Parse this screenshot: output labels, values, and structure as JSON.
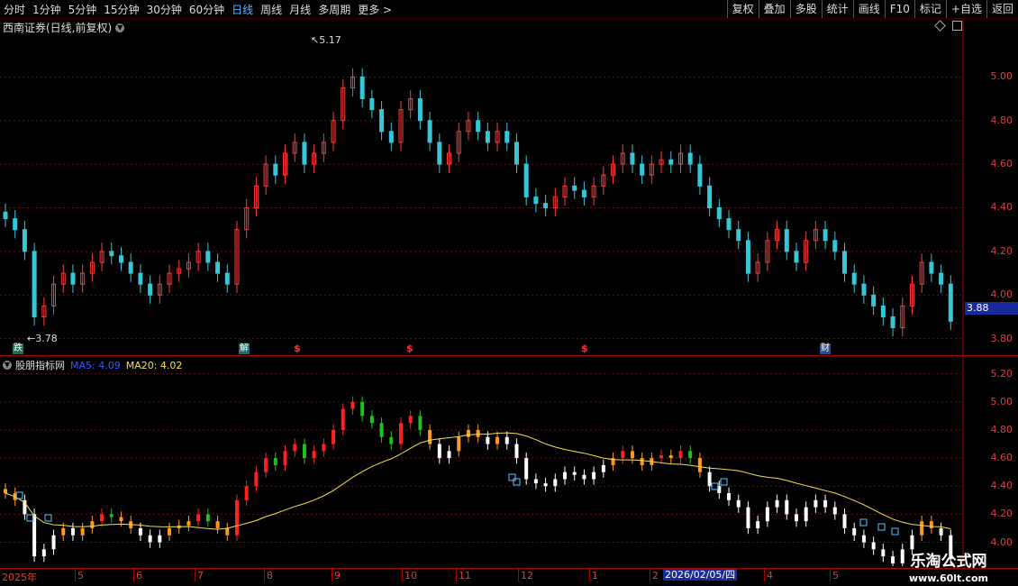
{
  "toolbar": {
    "periods": [
      "分时",
      "1分钟",
      "5分钟",
      "15分钟",
      "30分钟",
      "60分钟",
      "日线",
      "周线",
      "月线",
      "多周期",
      "更多 >"
    ],
    "active_period": "日线",
    "right_buttons": [
      "复权",
      "叠加",
      "多股",
      "统计",
      "画线",
      "F10",
      "标记",
      "+自选",
      "返回"
    ]
  },
  "stock_title": "西南证券(日线,前复权)",
  "max_price_label": "5.17",
  "min_price_label": "3.78",
  "current_price": "3.88",
  "main_axis": [
    "5.00",
    "4.80",
    "4.60",
    "4.40",
    "4.20",
    "4.00",
    "3.80"
  ],
  "indicator": {
    "name": "股朋指标网",
    "ma5": "MA5: 4.09",
    "ma20": "MA20: 4.02"
  },
  "indicator_axis": [
    "5.20",
    "5.00",
    "4.80",
    "4.60",
    "4.40",
    "4.20",
    "4.00"
  ],
  "tags": {
    "die": "跌",
    "jie": "解",
    "cai": "财",
    "s": "$"
  },
  "date_labels": [
    "2025年",
    "5",
    "6",
    "7",
    "8",
    "9",
    "10",
    "11",
    "12",
    "1",
    "2",
    "3",
    "4",
    "5"
  ],
  "selected_date": "2026/02/05/四",
  "watermark": {
    "line1": "乐淘公式网",
    "line2": "www.60lt.com"
  },
  "colors": {
    "up": "#ff3b3b",
    "down": "#36c6d6",
    "ma20": "#f3e24a",
    "ma5": "#3355ff"
  },
  "chart_data": {
    "type": "candlestick",
    "closes": [
      4.35,
      4.3,
      4.2,
      3.9,
      3.95,
      4.05,
      4.1,
      4.05,
      4.1,
      4.15,
      4.2,
      4.18,
      4.15,
      4.1,
      4.05,
      4.0,
      4.05,
      4.1,
      4.12,
      4.15,
      4.2,
      4.15,
      4.1,
      4.05,
      4.3,
      4.4,
      4.5,
      4.6,
      4.55,
      4.65,
      4.7,
      4.6,
      4.65,
      4.7,
      4.8,
      4.95,
      5.0,
      4.9,
      4.85,
      4.75,
      4.7,
      4.85,
      4.9,
      4.8,
      4.7,
      4.6,
      4.65,
      4.75,
      4.8,
      4.75,
      4.7,
      4.75,
      4.7,
      4.6,
      4.45,
      4.42,
      4.4,
      4.45,
      4.5,
      4.48,
      4.45,
      4.5,
      4.55,
      4.6,
      4.65,
      4.6,
      4.55,
      4.6,
      4.62,
      4.6,
      4.65,
      4.6,
      4.5,
      4.4,
      4.35,
      4.3,
      4.25,
      4.1,
      4.15,
      4.25,
      4.3,
      4.2,
      4.15,
      4.25,
      4.3,
      4.25,
      4.2,
      4.1,
      4.05,
      4.0,
      3.95,
      3.9,
      3.85,
      3.95,
      4.05,
      4.15,
      4.1,
      4.05,
      3.88
    ]
  }
}
